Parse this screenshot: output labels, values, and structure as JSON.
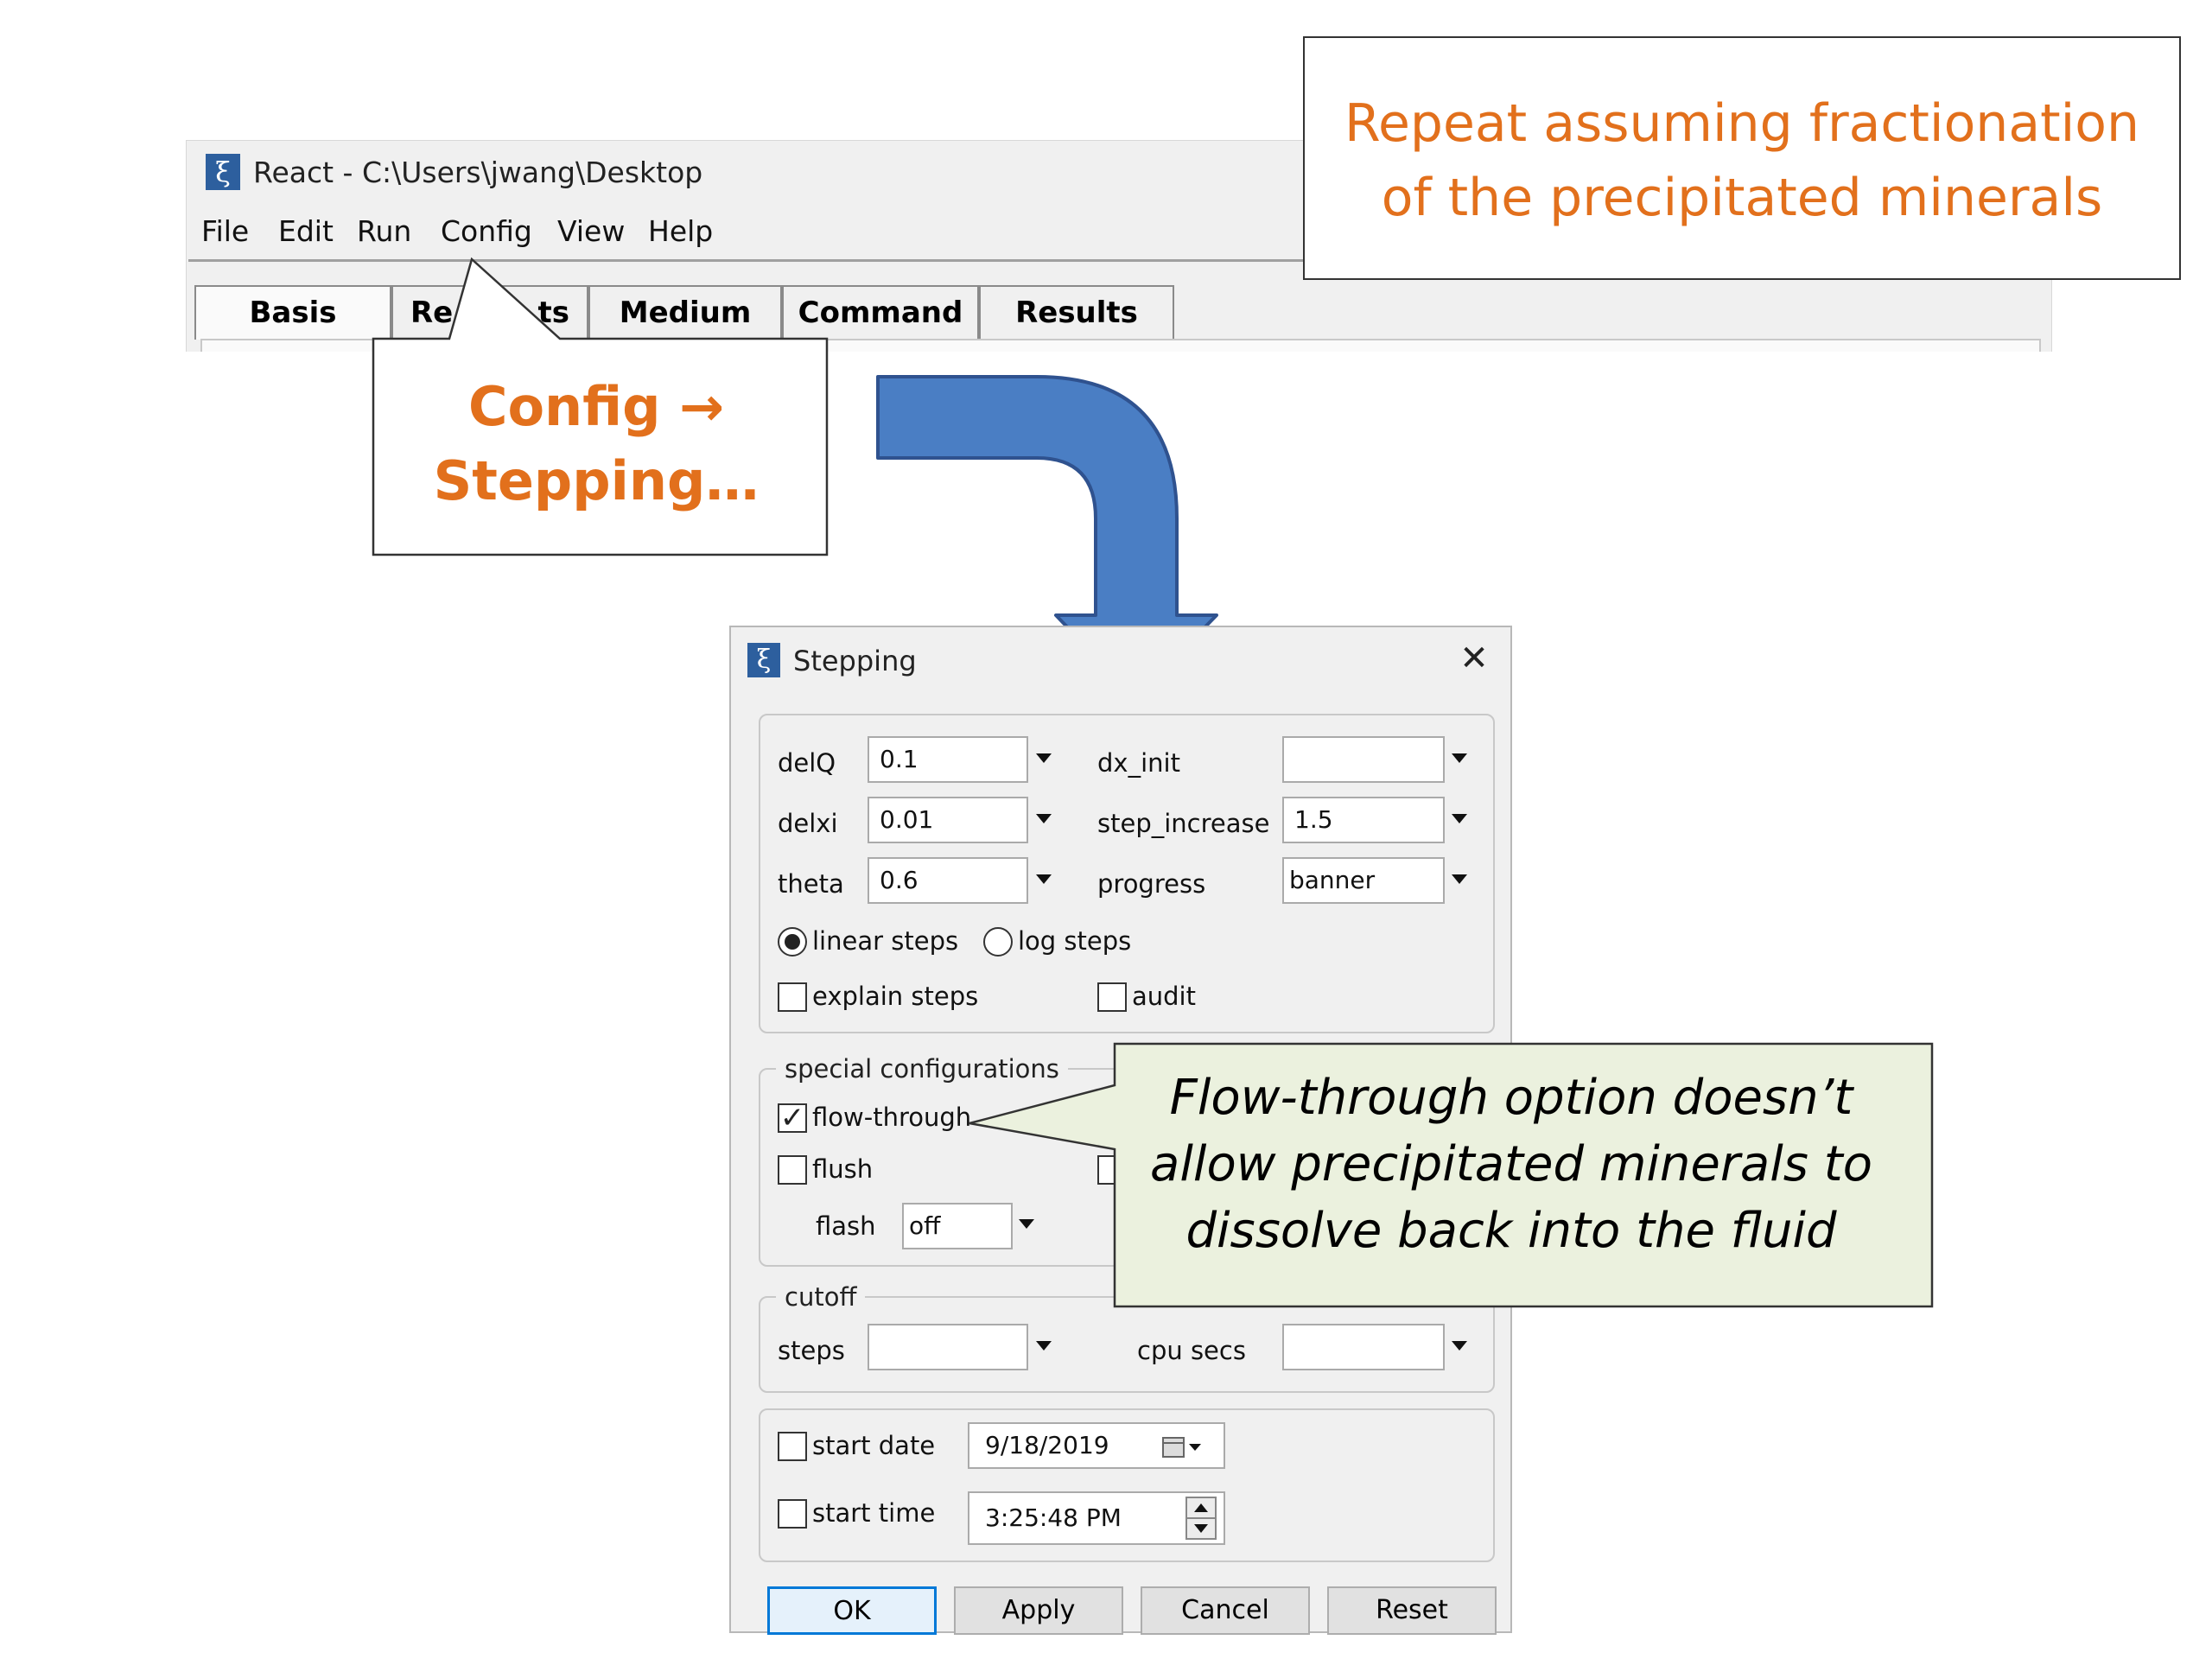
{
  "react_window": {
    "title": "React - C:\\Users\\jwang\\Desktop",
    "app_icon_glyph": "ξ",
    "menu": [
      "File",
      "Edit",
      "Run",
      "Config",
      "View",
      "Help"
    ],
    "tabs": [
      "Basis",
      "Re",
      "ts",
      "Medium",
      "Command",
      "Results"
    ]
  },
  "callouts": {
    "repeat": [
      "Repeat assuming fractionation",
      "of the precipitated minerals"
    ],
    "config": [
      "Config →",
      "Stepping…"
    ],
    "flow_through": [
      "Flow-through option doesn’t",
      "allow precipitated minerals to",
      "dissolve back into the fluid"
    ]
  },
  "stepping_dialog": {
    "title": "Stepping",
    "app_icon_glyph": "ξ",
    "close_glyph": "✕",
    "fields": {
      "delQ": {
        "label": "delQ",
        "value": "0.1"
      },
      "delxi": {
        "label": "delxi",
        "value": "0.01"
      },
      "theta": {
        "label": "theta",
        "value": "0.6"
      },
      "dx_init": {
        "label": "dx_init",
        "value": ""
      },
      "step_increase": {
        "label": "step_increase",
        "value": "1.5"
      },
      "progress": {
        "label": "progress",
        "value": "banner"
      }
    },
    "linear_steps": {
      "label": "linear steps",
      "selected": true
    },
    "log_steps": {
      "label": "log steps",
      "selected": false
    },
    "explain_steps": {
      "label": "explain steps",
      "checked": false
    },
    "audit": {
      "label": "audit",
      "checked": false
    },
    "special_configurations": {
      "legend": "special configurations",
      "flow_through": {
        "label": "flow-through",
        "checked": true
      },
      "flush": {
        "label": "flush",
        "checked": false
      },
      "flash": {
        "label": "flash",
        "value": "off"
      }
    },
    "cutoff": {
      "legend": "cutoff",
      "steps": {
        "label": "steps",
        "value": ""
      },
      "cpu_secs": {
        "label": "cpu secs",
        "value": ""
      }
    },
    "start_date": {
      "label": "start date",
      "checked": false,
      "value": "9/18/2019"
    },
    "start_time": {
      "label": "start time",
      "checked": false,
      "value": "3:25:48 PM"
    },
    "buttons": {
      "ok": "OK",
      "apply": "Apply",
      "cancel": "Cancel",
      "reset": "Reset"
    }
  },
  "colors": {
    "callout_orange": "#e2701c",
    "arrow_blue": "#4a7ec4",
    "arrow_outline": "#2f528f",
    "flow_callout_bg": "#ebf1de",
    "window_bg": "#f0f0f0",
    "app_icon_bg": "#2d5f9e",
    "ok_focus_border": "#0078d7"
  },
  "icons": {
    "app": "xi-app-icon",
    "dropdown": "triangle-down-icon",
    "calendar": "calendar-icon",
    "spinner": "spin-up-down-icon",
    "close": "close-icon",
    "big_arrow": "curved-down-arrow-icon"
  }
}
